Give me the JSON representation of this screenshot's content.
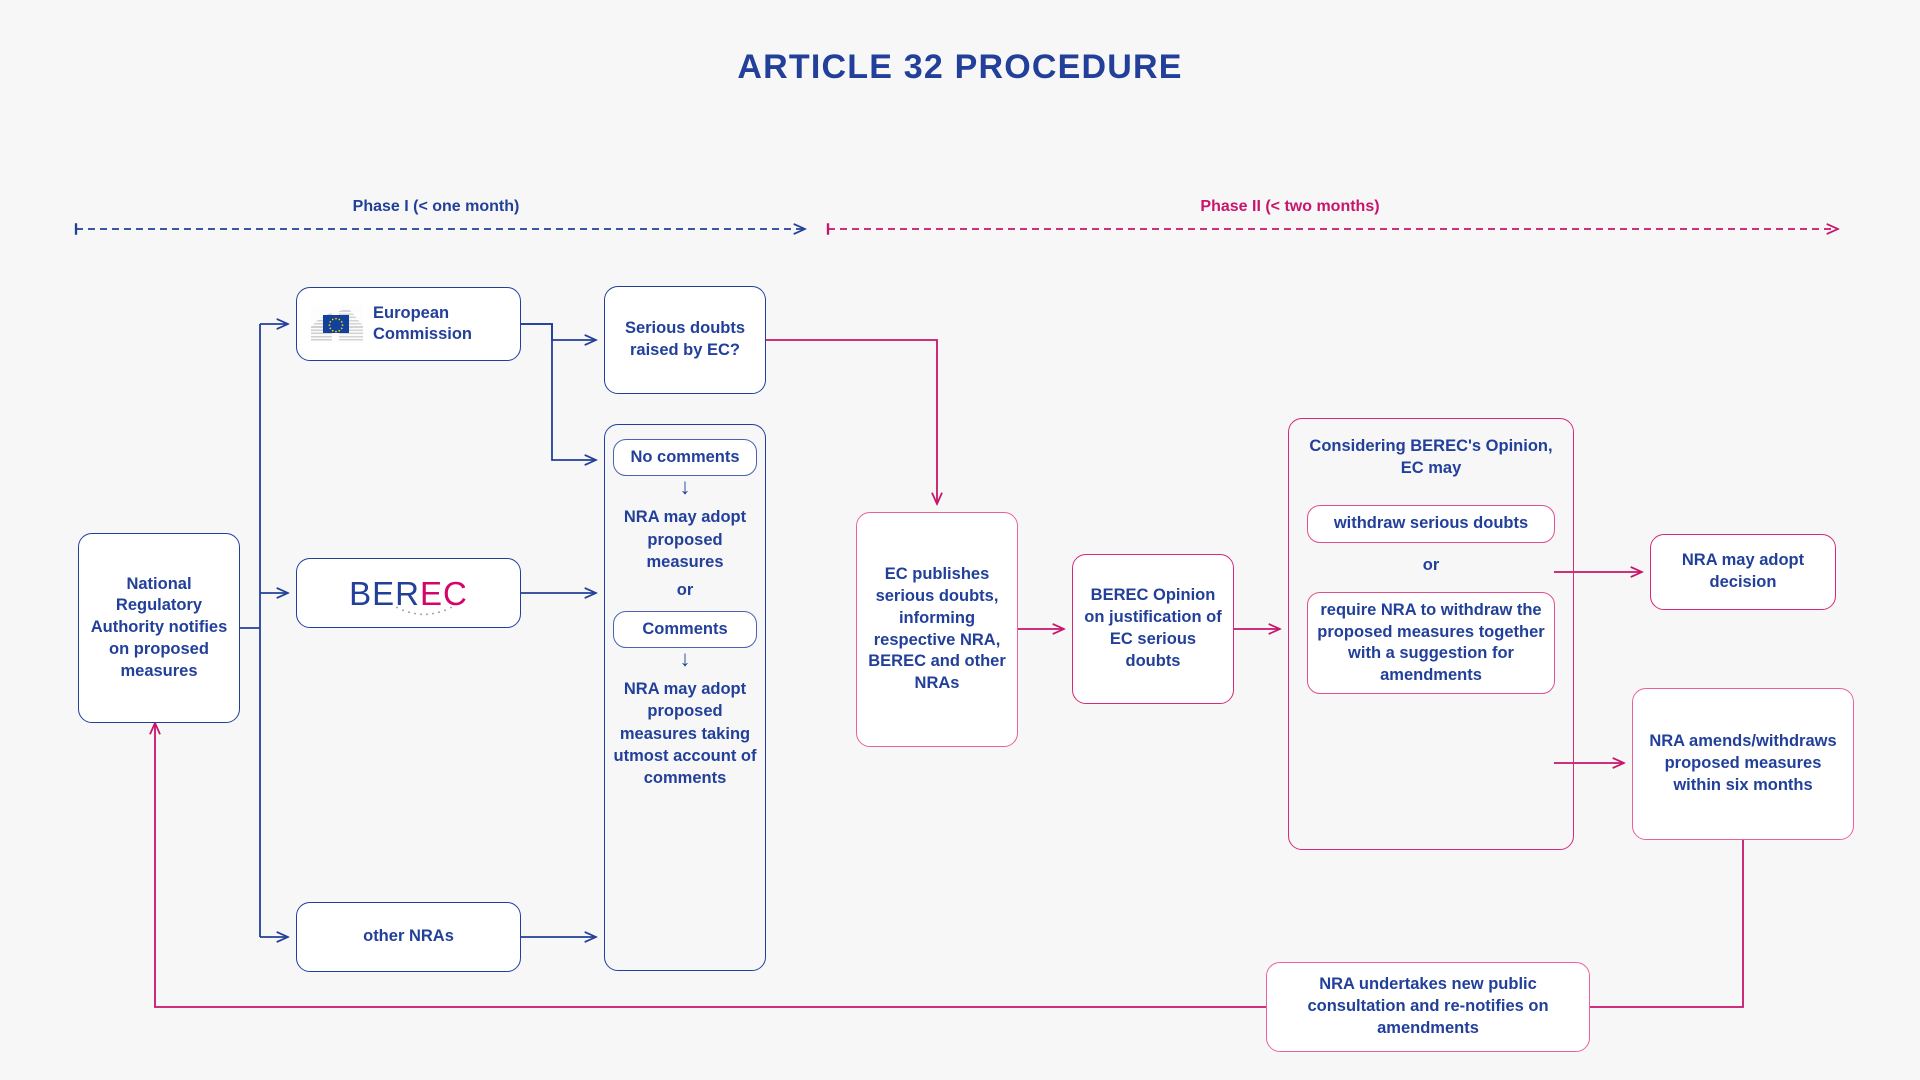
{
  "title": "ARTICLE 32 PROCEDURE",
  "colors": {
    "navy": "#22409a",
    "crimson": "#c8156b",
    "background": "#f7f7f7",
    "box_border_navy": "#22409a",
    "box_border_pink": "#d42a78"
  },
  "phases": [
    {
      "id": "phase-1",
      "label": "Phase I (< one month)",
      "color": "#22409a"
    },
    {
      "id": "phase-2",
      "label": "Phase II (< two months)",
      "color": "#c8156b"
    }
  ],
  "nodes": {
    "nra_notifies": "National Regulatory Authority notifies on proposed measures",
    "european_commission": "European Commission",
    "berec_logo_part1": "BER",
    "berec_logo_part2": "EC",
    "other_nras": "other NRAs",
    "serious_doubts_raised": "Serious doubts raised by EC?",
    "no_comments": "No comments",
    "nra_may_adopt_1": "NRA may adopt proposed measures",
    "or_1": "or",
    "comments": "Comments",
    "nra_may_adopt_2": "NRA may adopt proposed measures taking utmost account of comments",
    "ec_publishes": "EC publishes serious doubts, informing respective NRA, BEREC and other NRAs",
    "berec_opinion": "BEREC Opinion on justification of EC serious doubts",
    "considering_head": "Considering BEREC's Opinion, EC may",
    "withdraw_serious_doubts": "withdraw serious doubts",
    "or_2": "or",
    "require_nra_withdraw": "require NRA to withdraw the proposed measures together with a suggestion for amendments",
    "nra_may_adopt_decision": "NRA may adopt decision",
    "nra_amends_withdraws": "NRA amends/withdraws proposed measures within six months",
    "nra_undertakes_new": "NRA undertakes new public consultation and re-notifies on amendments"
  },
  "arrow_glyph": "↓"
}
